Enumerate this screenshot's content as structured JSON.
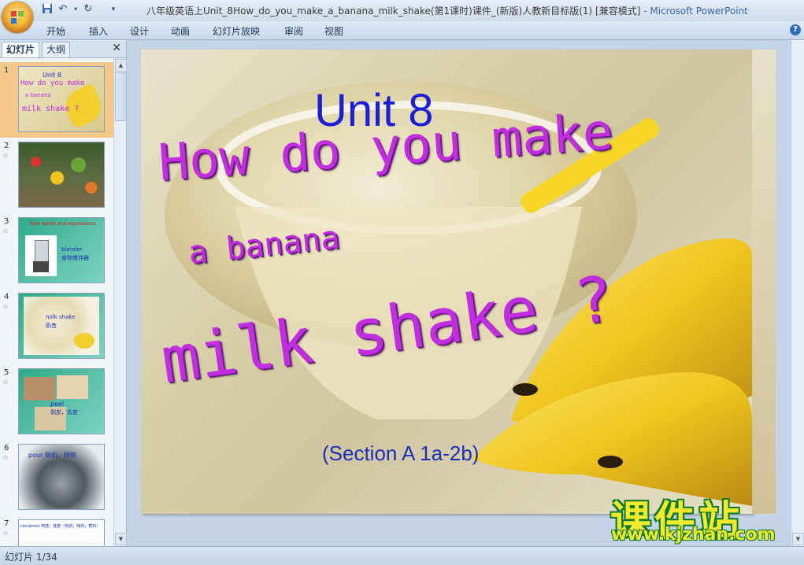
{
  "window": {
    "title": "八年级英语上Unit_8How_do_you_make_a_banana_milk_shake(第1课时)课件_(新版)人教新目标版(1) [兼容模式]",
    "app_name": "- Microsoft PowerPoint"
  },
  "ribbon": {
    "tabs": [
      "开始",
      "插入",
      "设计",
      "动画",
      "幻灯片放映",
      "审阅",
      "视图"
    ]
  },
  "left_pane": {
    "tabs": [
      "幻灯片",
      "大纲"
    ],
    "close_glyph": "✕",
    "thumbnails": [
      {
        "num": "1",
        "star": "",
        "texts": [
          "Unit 8",
          "How do you make",
          "a banana",
          "milk shake ?"
        ]
      },
      {
        "num": "2",
        "star": "☆",
        "texts": []
      },
      {
        "num": "3",
        "star": "☆",
        "texts": [
          "New words and expressions",
          "blender",
          "食物搅拌器"
        ]
      },
      {
        "num": "4",
        "star": "☆",
        "texts": [
          "milk shake",
          "奶昔"
        ]
      },
      {
        "num": "5",
        "star": "☆",
        "texts": [
          "peel",
          "剥皮，去皮"
        ]
      },
      {
        "num": "6",
        "star": "☆",
        "texts": [
          "pour 倒出，倾倒"
        ]
      },
      {
        "num": "7",
        "star": "☆",
        "texts": [
          "cinnamon 肉桂，桂皮（色的，味的，香料）"
        ]
      }
    ]
  },
  "slide": {
    "unit": "Unit 8",
    "line1": "How do you make",
    "line2": "a banana",
    "line3": "milk shake ?",
    "section": "(Section A 1a-2b)"
  },
  "watermark": {
    "chinese": "课件站",
    "url": "www.kjzhan.com"
  },
  "status": {
    "slide_info": "幻灯片 1/34"
  },
  "colors": {
    "title_blue": "#1d1fd6",
    "wordart_purple": "#c02ee0",
    "watermark_yellow": "#f2ea2c",
    "watermark_green": "#0c7a2a"
  }
}
